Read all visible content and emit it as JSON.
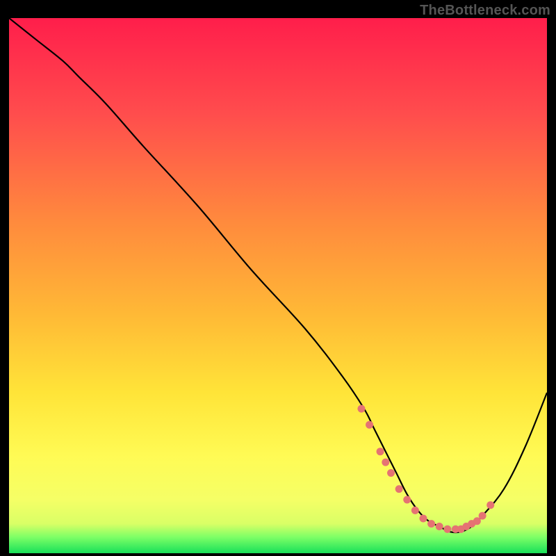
{
  "watermark": "TheBottleneck.com",
  "colors": {
    "background": "#000000",
    "watermark_text": "#555555",
    "curve": "#000000",
    "dots": "#e57373",
    "gradient_stops": [
      {
        "offset": 0.0,
        "color": "#ff1e4b"
      },
      {
        "offset": 0.18,
        "color": "#ff4d4d"
      },
      {
        "offset": 0.38,
        "color": "#ff8a3d"
      },
      {
        "offset": 0.55,
        "color": "#ffb836"
      },
      {
        "offset": 0.7,
        "color": "#ffe438"
      },
      {
        "offset": 0.82,
        "color": "#fffb55"
      },
      {
        "offset": 0.9,
        "color": "#f5ff66"
      },
      {
        "offset": 0.945,
        "color": "#d9ff66"
      },
      {
        "offset": 0.97,
        "color": "#7dff66"
      },
      {
        "offset": 1.0,
        "color": "#18e05a"
      }
    ]
  },
  "chart_data": {
    "type": "line",
    "title": "",
    "xlabel": "",
    "ylabel": "",
    "xlim": [
      0,
      100
    ],
    "ylim": [
      0,
      100
    ],
    "grid": false,
    "legend": false,
    "series": [
      {
        "name": "bottleneck-curve",
        "x": [
          0,
          5,
          10,
          13,
          18,
          25,
          35,
          45,
          55,
          62,
          66,
          68,
          70,
          72,
          74,
          76,
          78,
          80,
          82,
          84,
          86,
          88,
          92,
          96,
          100
        ],
        "y": [
          100,
          96,
          92,
          89,
          84,
          76,
          65,
          53,
          42,
          33,
          27,
          23,
          19,
          15,
          11,
          8,
          6,
          5,
          4,
          4,
          5,
          7,
          12,
          20,
          30
        ]
      }
    ],
    "highlight_dots": {
      "name": "optimal-range",
      "x": [
        65.5,
        67,
        69,
        70,
        71,
        72.5,
        74,
        75.5,
        77,
        78.5,
        80,
        81.5,
        83,
        84,
        85,
        86,
        87,
        88,
        89.5
      ],
      "y": [
        27,
        24,
        19,
        17,
        15,
        12,
        10,
        8,
        6.5,
        5.5,
        5,
        4.5,
        4.5,
        4.5,
        5,
        5.5,
        6,
        7,
        9
      ]
    }
  }
}
